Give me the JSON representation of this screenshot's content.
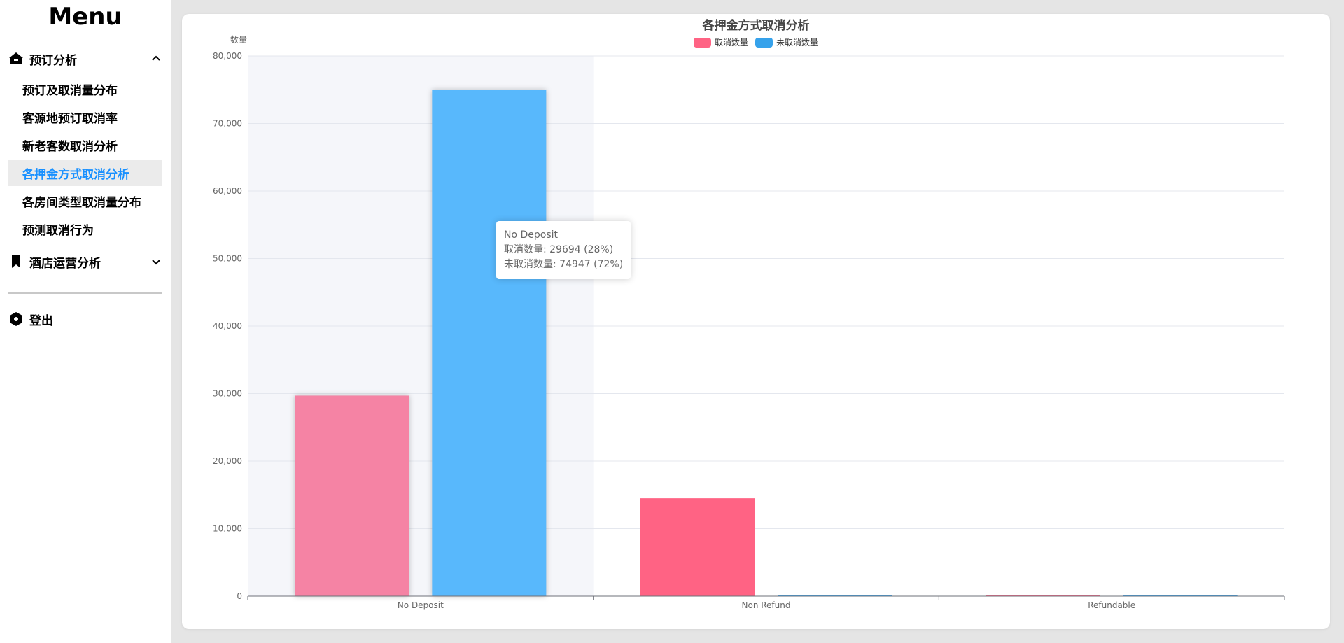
{
  "sidebar": {
    "title": "Menu",
    "groups": [
      {
        "label": "预订分析",
        "icon": "home-icon",
        "expanded": true,
        "items": [
          "预订及取消量分布",
          "客源地预订取消率",
          "新老客数取消分析",
          "各押金方式取消分析",
          "各房间类型取消量分布",
          "预测取消行为"
        ],
        "active_index": 3
      },
      {
        "label": "酒店运营分析",
        "icon": "bookmark-icon",
        "expanded": false
      }
    ],
    "logout": {
      "label": "登出",
      "icon": "hexagon-icon"
    }
  },
  "colors": {
    "accent": "#1890ff",
    "cancel": "#ff6384",
    "cancel_emphasis": "#f583a4",
    "not_cancel": "#36a2eb",
    "not_cancel_emphasis": "#58b8fc",
    "hover_band": "#f5f6fa"
  },
  "chart_data": {
    "type": "bar",
    "title": "各押金方式取消分析",
    "ylabel": "数量",
    "xlabel": "",
    "categories": [
      "No Deposit",
      "Non Refund",
      "Refundable"
    ],
    "series": [
      {
        "name": "取消数量",
        "values": [
          29694,
          14494,
          36
        ]
      },
      {
        "name": "未取消数量",
        "values": [
          74947,
          93,
          126
        ]
      }
    ],
    "ylim": [
      0,
      80000
    ],
    "yticks": [
      0,
      10000,
      20000,
      30000,
      40000,
      50000,
      60000,
      70000,
      80000
    ],
    "ytick_labels": [
      "0",
      "10,000",
      "20,000",
      "30,000",
      "40,000",
      "50,000",
      "60,000",
      "70,000",
      "80,000"
    ],
    "grid": true,
    "legend_position": "top-center",
    "highlighted_category": "No Deposit",
    "tooltip": {
      "title": "No Deposit",
      "lines": [
        "取消数量: 29694 (28%)",
        "未取消数量: 74947 (72%)"
      ]
    }
  }
}
